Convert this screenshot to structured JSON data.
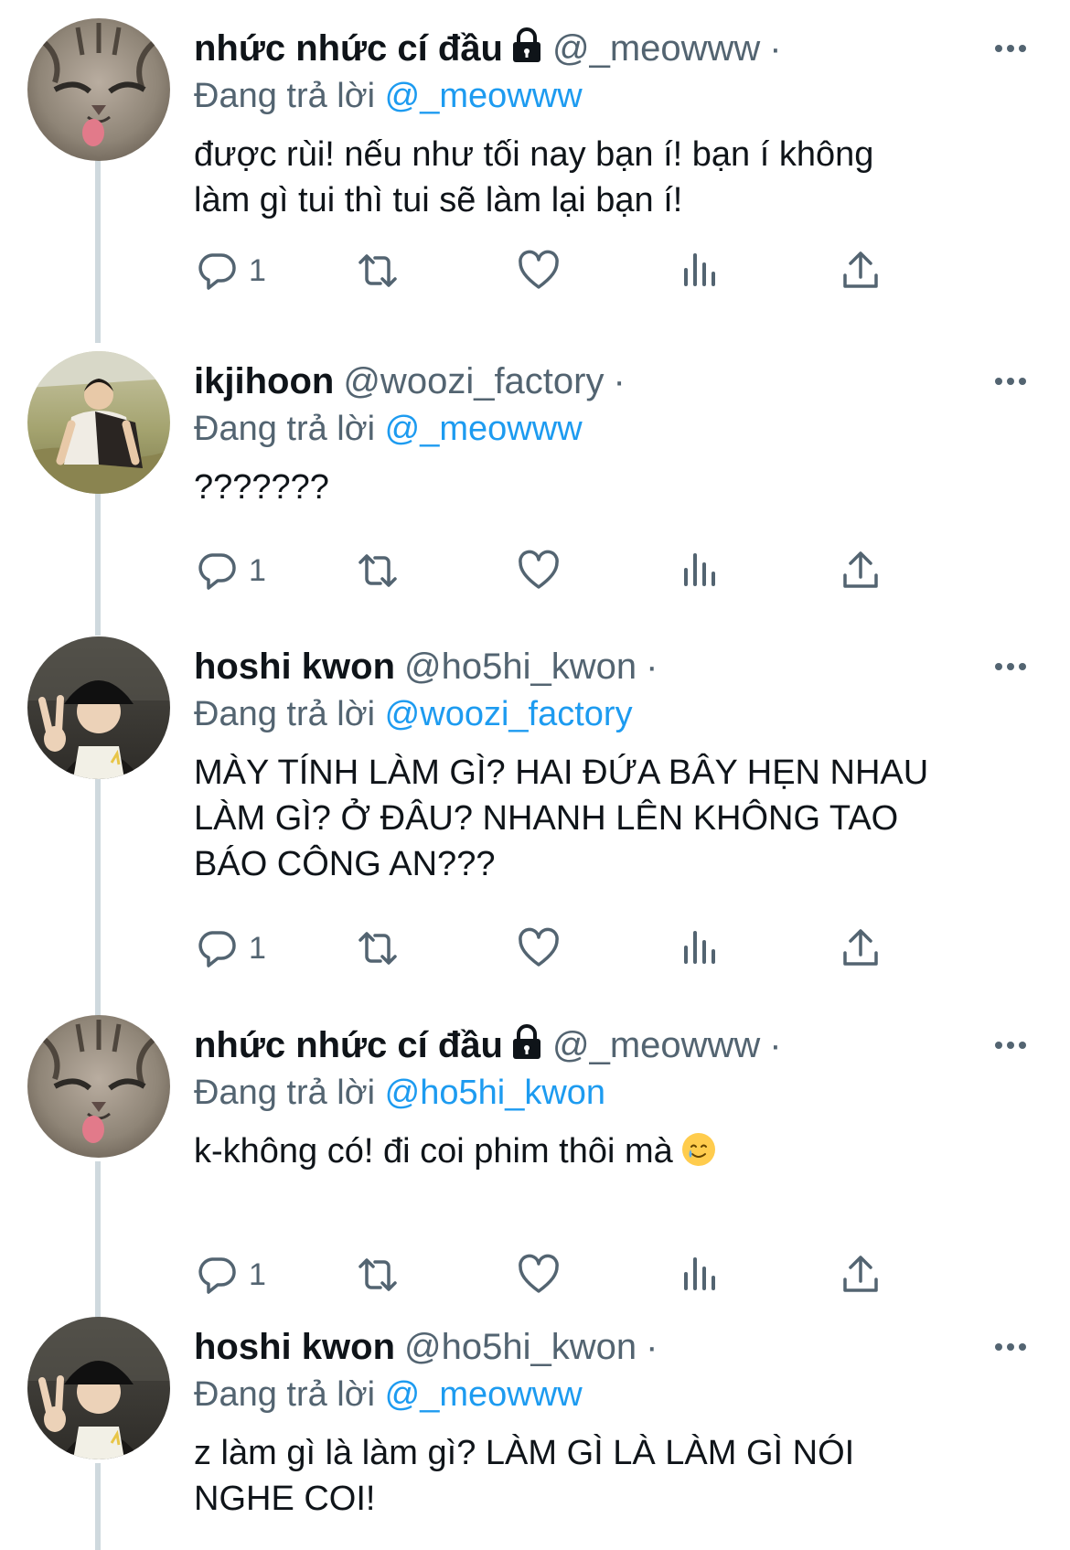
{
  "colors": {
    "accent": "#1d9bf0",
    "muted": "#536471",
    "text": "#0f1419",
    "thread": "#cfd9de"
  },
  "tweets": [
    {
      "name": "nhức nhức cí đầu",
      "locked": true,
      "handle": "@_meowww",
      "dot": "·",
      "reply_prefix": "Đang trả lời",
      "reply_to": "@_meowww",
      "text": "được rùi! nếu như tối nay bạn í! bạn í không\nlàm gì tui thì tui sẽ làm lại bạn í!",
      "reply_count": "1",
      "avatar": "cat-avatar"
    },
    {
      "name": "ikjihoon",
      "locked": false,
      "handle": "@woozi_factory",
      "dot": "·",
      "reply_prefix": "Đang trả lời",
      "reply_to": "@_meowww",
      "text": "???????",
      "reply_count": "1",
      "avatar": "person-field-avatar"
    },
    {
      "name": "hoshi kwon",
      "locked": false,
      "handle": "@ho5hi_kwon",
      "dot": "·",
      "reply_prefix": "Đang trả lời",
      "reply_to": "@woozi_factory",
      "text": "MÀY TÍNH LÀM GÌ? HAI ĐỨA BÂY HẸN NHAU\nLÀM GÌ? Ở ĐÂU? NHANH LÊN KHÔNG TAO\nBÁO CÔNG AN???",
      "reply_count": "1",
      "avatar": "person-hat-avatar"
    },
    {
      "name": "nhức nhức cí đầu",
      "locked": true,
      "handle": "@_meowww",
      "dot": "·",
      "reply_prefix": "Đang trả lời",
      "reply_to": "@ho5hi_kwon",
      "text": "k-không có! đi coi phim thôi mà",
      "emoji": "smiling-face-with-tear-emoji",
      "reply_count": "1",
      "avatar": "cat-avatar"
    },
    {
      "name": "hoshi kwon",
      "locked": false,
      "handle": "@ho5hi_kwon",
      "dot": "·",
      "reply_prefix": "Đang trả lời",
      "reply_to": "@_meowww",
      "text": "z làm gì là làm gì? LÀM GÌ LÀ LÀM GÌ NÓI\nNGHE COI!",
      "reply_count": "",
      "avatar": "person-hat-avatar"
    }
  ]
}
